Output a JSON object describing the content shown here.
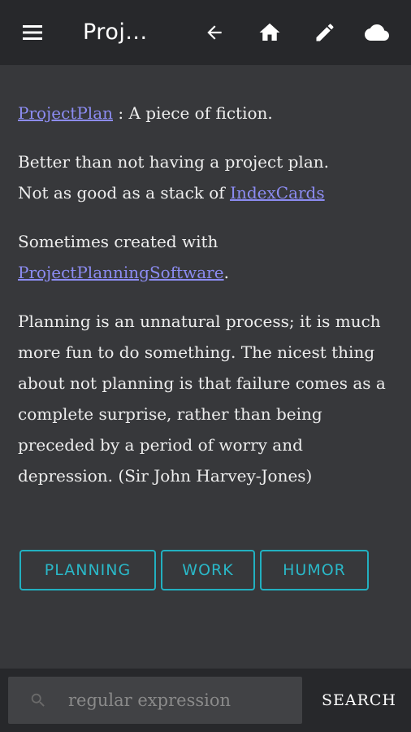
{
  "header": {
    "title": "Proj...",
    "icons": [
      "menu-icon",
      "back-arrow-icon",
      "home-icon",
      "edit-pencil-icon",
      "cloud-icon"
    ]
  },
  "content": {
    "p1": {
      "link": "ProjectPlan",
      "text": " : A piece of fiction."
    },
    "p2": {
      "line1": "Better than not having a project plan.",
      "text": "Not as good as a stack of ",
      "link": "IndexCards"
    },
    "p3": {
      "text": "Sometimes created with ",
      "link": "ProjectPlanningSoftware",
      "suffix": "."
    },
    "p4": {
      "text": "Planning is an unnatural process; it is much more fun to do something. The nicest thing about not planning is that failure comes as a complete surprise, rather than being preceded by a period of worry and depression. (Sir John Harvey-Jones)"
    }
  },
  "tags": [
    {
      "label": "PLANNING"
    },
    {
      "label": "WORK"
    },
    {
      "label": "HUMOR"
    }
  ],
  "search": {
    "placeholder": "regular expression",
    "button_label": "SEARCH"
  },
  "colors": {
    "background": "#37383b",
    "bar": "#27282b",
    "link": "#8c8cf2",
    "tag_accent": "#22b0c0"
  }
}
